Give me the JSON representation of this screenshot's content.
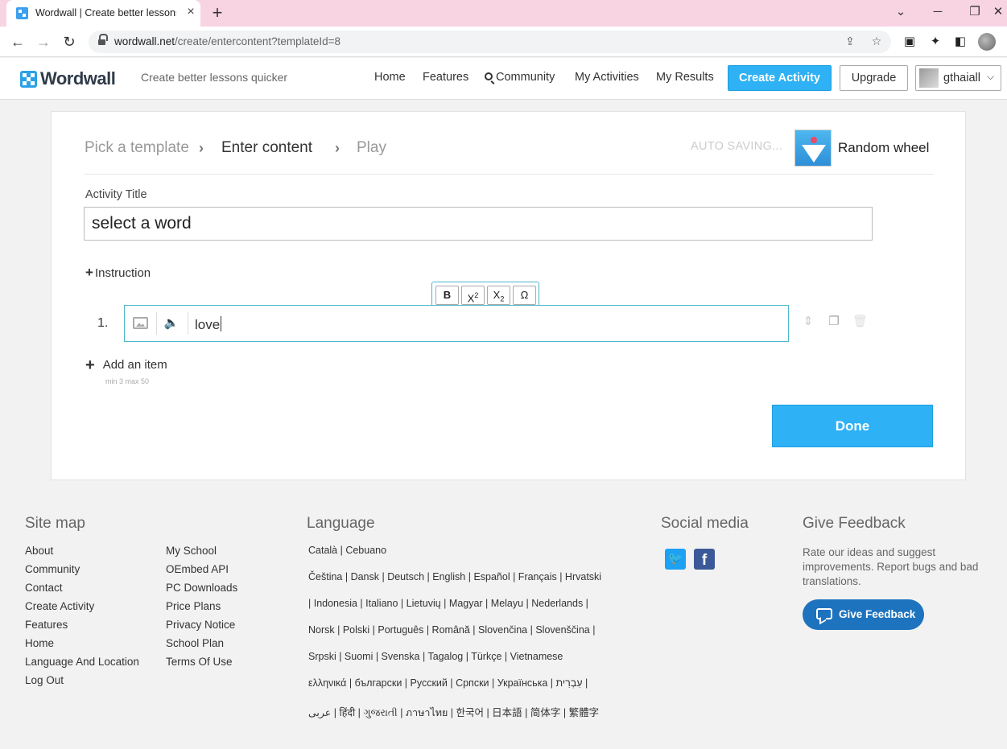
{
  "browser": {
    "tab_title": "Wordwall | Create better lessons",
    "tab_close": "×",
    "new_tab": "+",
    "url_domain": "wordwall.net",
    "url_path": "/create/entercontent?templateId=8",
    "win_minimize": "─",
    "win_restore": "❐",
    "win_close": "✕",
    "tab_list": "⌄"
  },
  "header": {
    "logo_text": "Wordwall",
    "tagline": "Create better lessons quicker",
    "nav": [
      "Home",
      "Features",
      "Community",
      "My Activities",
      "My Results"
    ],
    "create_label": "Create Activity",
    "upgrade_label": "Upgrade",
    "user_name": "gthaiall"
  },
  "steps": {
    "pick": "Pick a template",
    "enter": "Enter content",
    "play": "Play",
    "autosave": "AUTO SAVING...",
    "template_name": "Random wheel"
  },
  "form": {
    "title_label": "Activity Title",
    "title_value": "select a word",
    "instruction_label": "Instruction",
    "format_buttons": [
      "B",
      "X",
      "X",
      "Ω"
    ],
    "item_number": "1.",
    "item_value": "love",
    "add_item_label": "Add an item",
    "add_item_hint": "min 3   max 50",
    "done_label": "Done"
  },
  "footer": {
    "sitemap_heading": "Site map",
    "sitemap_col1": [
      "About",
      "Community",
      "Contact",
      "Create Activity",
      "Features",
      "Home",
      "Language And Location",
      "Log Out"
    ],
    "sitemap_col2": [
      "My School",
      "OEmbed API",
      "PC Downloads",
      "Price Plans",
      "Privacy Notice",
      "School Plan",
      "Terms Of Use"
    ],
    "language_heading": "Language",
    "language_rows": [
      "Català | Cebuano",
      "Čeština | Dansk | Deutsch | English | Español | Français | Hrvatski",
      "| Indonesia | Italiano | Lietuvių | Magyar | Melayu | Nederlands |",
      "Norsk | Polski | Português | Română | Slovenčina | Slovenščina |",
      "Srpski | Suomi | Svenska | Tagalog | Türkçe | Vietnamese",
      "ελληνικά | български | Русский | Српски | Українська | עִבְרִית |",
      "عربى | हिंदी | ગુજરાતી | ภาษาไทย | 한국어 | 日本語 | 简体字 | 繁體字"
    ],
    "social_heading": "Social media",
    "feedback_heading": "Give Feedback",
    "feedback_text": "Rate our ideas and suggest improvements. Report bugs and bad translations.",
    "feedback_button": "Give Feedback"
  },
  "colors": {
    "accent": "#2eb1f5",
    "feedback_button": "#1e73be",
    "tab_strip": "#f8d4e3"
  }
}
